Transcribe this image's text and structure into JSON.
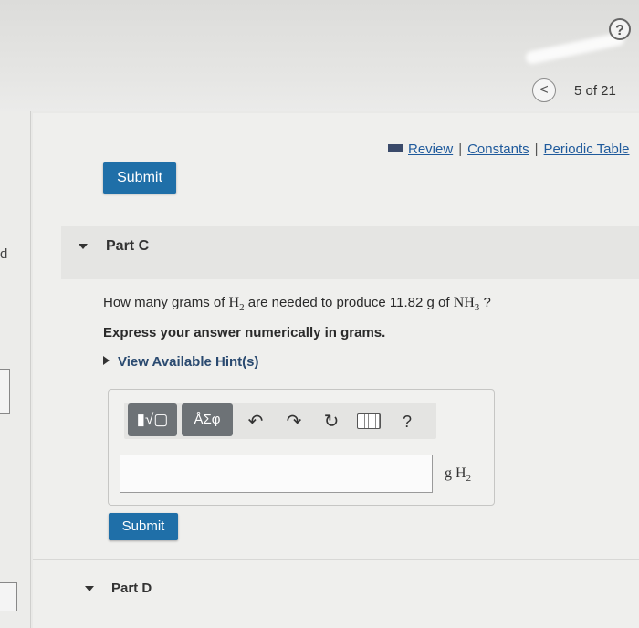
{
  "header": {
    "help_icon": "?",
    "prev_icon": "<",
    "page_counter": "5 of 21"
  },
  "resources": {
    "review": "Review",
    "constants": "Constants",
    "periodic_table": "Periodic Table",
    "separator": "|"
  },
  "part_b": {
    "submit_label": "Submit"
  },
  "part_c": {
    "title": "Part C",
    "question_prefix": "How many grams of ",
    "h2_symbol": "H",
    "h2_sub": "2",
    "question_middle": " are needed to produce 11.82 g of ",
    "nh3_symbol": "NH",
    "nh3_sub": "3",
    "question_suffix": " ?",
    "instruction": "Express your answer numerically in grams.",
    "hint": "View Available Hint(s)",
    "toolbar": {
      "templates_icon": "▮√▢",
      "symbols_icon": "ÅΣφ",
      "undo_icon": "↶",
      "redo_icon": "↷",
      "reset_icon": "↻",
      "help_label": "?"
    },
    "answer_value": "",
    "unit_g": "g H",
    "unit_sub": "2",
    "submit_label": "Submit"
  },
  "part_d": {
    "title": "Part D"
  },
  "left_fragment": "d",
  "colors": {
    "submit_bg": "#1f6fa8",
    "link": "#1f5a9c"
  }
}
